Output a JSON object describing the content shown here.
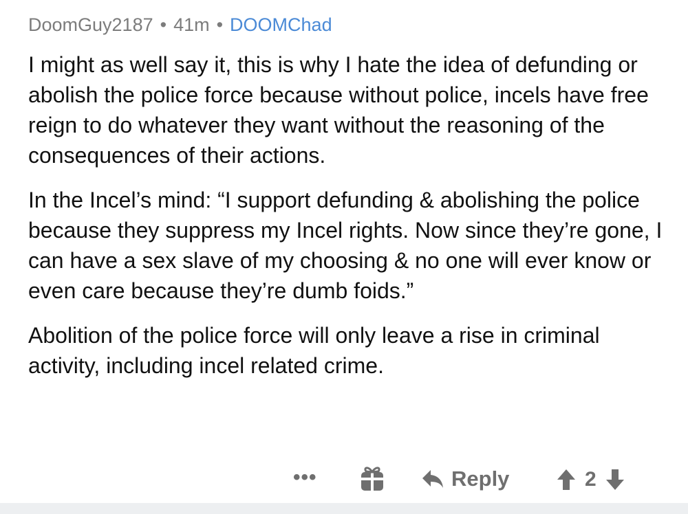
{
  "comment": {
    "author": "DoomGuy2187",
    "separator": "•",
    "age": "41m",
    "flair": "DOOMChad",
    "paragraphs": [
      "I might as well say it, this is why I hate the idea of defunding or abolish the police force because without police, incels have free reign to do whatever they want without the reasoning of the consequences of their actions.",
      "In the Incel’s mind: “I support defunding & abolishing the police because they suppress my Incel rights. Now since they’re gone, I can have a sex slave of my choosing & no one will ever know or even care because they’re dumb foids.”",
      "Abolition of the police force will only leave a rise in criminal activity, including incel related crime."
    ]
  },
  "actions": {
    "more_label": "•••",
    "gift_icon": "gift-icon",
    "reply_icon": "reply-arrow-icon",
    "reply_label": "Reply",
    "upvote_icon": "upvote-arrow-icon",
    "score": "2",
    "downvote_icon": "downvote-arrow-icon"
  },
  "colors": {
    "meta": "#7c7c7c",
    "flair": "#4b8ad6",
    "action": "#6f6f6f",
    "bottom_bar": "#edeff1"
  }
}
